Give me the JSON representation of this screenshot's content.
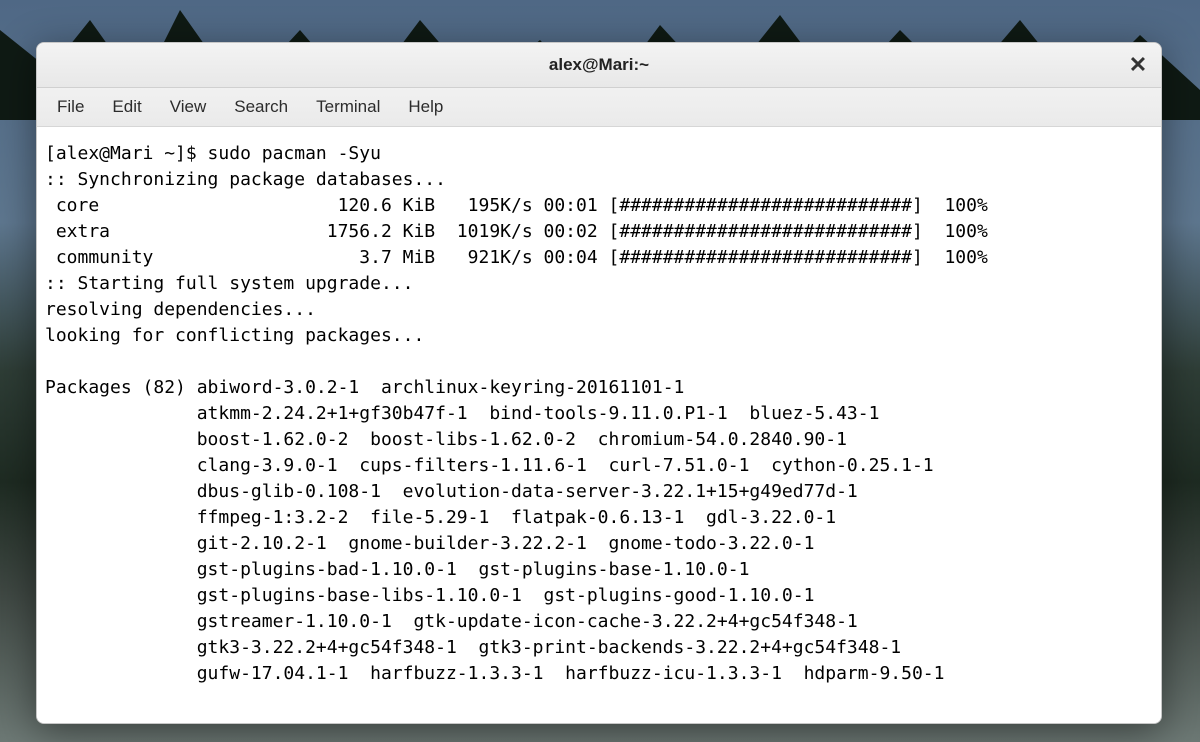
{
  "window": {
    "title": "alex@Mari:~",
    "close": "✕"
  },
  "menubar": [
    "File",
    "Edit",
    "View",
    "Search",
    "Terminal",
    "Help"
  ],
  "term": {
    "prompt": "[alex@Mari ~]$ ",
    "command": "sudo pacman -Syu",
    "sync_line": ":: Synchronizing package databases...",
    "downloads": [
      {
        "name": "core",
        "size": "120.6 KiB",
        "rate": "195K/s",
        "eta": "00:01",
        "bar": "[###########################]",
        "pct": "100%"
      },
      {
        "name": "extra",
        "size": "1756.2 KiB",
        "rate": "1019K/s",
        "eta": "00:02",
        "bar": "[###########################]",
        "pct": "100%"
      },
      {
        "name": "community",
        "size": "3.7 MiB",
        "rate": "921K/s",
        "eta": "00:04",
        "bar": "[###########################]",
        "pct": "100%"
      }
    ],
    "upgrade_line": ":: Starting full system upgrade...",
    "resolving": "resolving dependencies...",
    "looking": "looking for conflicting packages...",
    "packages_count": 82,
    "package_lines": [
      "abiword-3.0.2-1  archlinux-keyring-20161101-1",
      "atkmm-2.24.2+1+gf30b47f-1  bind-tools-9.11.0.P1-1  bluez-5.43-1",
      "boost-1.62.0-2  boost-libs-1.62.0-2  chromium-54.0.2840.90-1",
      "clang-3.9.0-1  cups-filters-1.11.6-1  curl-7.51.0-1  cython-0.25.1-1",
      "dbus-glib-0.108-1  evolution-data-server-3.22.1+15+g49ed77d-1",
      "ffmpeg-1:3.2-2  file-5.29-1  flatpak-0.6.13-1  gdl-3.22.0-1",
      "git-2.10.2-1  gnome-builder-3.22.2-1  gnome-todo-3.22.0-1",
      "gst-plugins-bad-1.10.0-1  gst-plugins-base-1.10.0-1",
      "gst-plugins-base-libs-1.10.0-1  gst-plugins-good-1.10.0-1",
      "gstreamer-1.10.0-1  gtk-update-icon-cache-3.22.2+4+gc54f348-1",
      "gtk3-3.22.2+4+gc54f348-1  gtk3-print-backends-3.22.2+4+gc54f348-1",
      "gufw-17.04.1-1  harfbuzz-1.3.3-1  harfbuzz-icu-1.3.3-1  hdparm-9.50-1"
    ]
  }
}
